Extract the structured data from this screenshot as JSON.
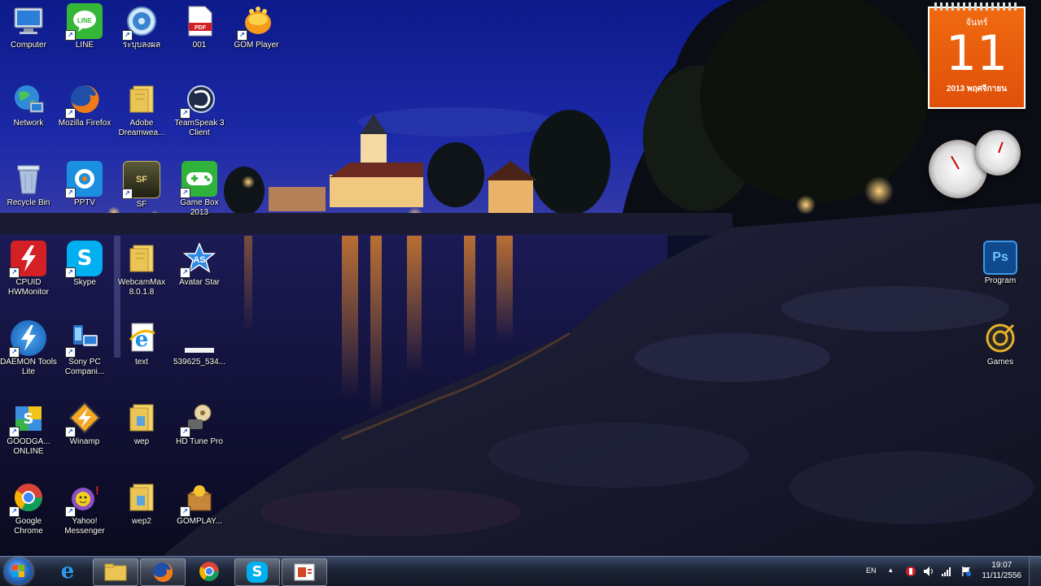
{
  "desktop_icons": {
    "computer": "Computer",
    "line": "LINE",
    "network_folder": "ระบุบลงผล",
    "file_001": "001",
    "gom_player": "GOM Player",
    "network": "Network",
    "firefox": "Mozilla Firefox",
    "dreamweaver": "Adobe Dreamwea...",
    "teamspeak": "TeamSpeak 3 Client",
    "recycle_bin": "Recycle Bin",
    "pptv": "PPTV",
    "sf": "SF",
    "game_box": "Game Box 2013",
    "cpuid": "CPUID HWMonitor",
    "skype": "Skype",
    "webcammax": "WebcamMax 8.0.1.8",
    "avatar_star": "Avatar Star",
    "daemon": "DAEMON Tools Lite",
    "sony_pc": "Sony PC Compani...",
    "text": "text",
    "file_539625": "539625_534...",
    "goodgame": "GOODGA... ONLINE",
    "winamp": "Winamp",
    "wep": "wep",
    "hdtune": "HD Tune Pro",
    "chrome": "Google Chrome",
    "yahoo": "Yahoo! Messenger",
    "wep2": "wep2",
    "gomplay": "GOMPLAY...",
    "program": "Program",
    "games": "Games"
  },
  "calendar": {
    "day_name": "จันทร์",
    "day": "11",
    "month_year": "2013 พฤศจิกายน"
  },
  "taskbar": {
    "language": "EN",
    "time": "19:07",
    "date": "11/11/2556"
  },
  "colors": {
    "calendar_orange": "#e8590c",
    "taskbar_dark": "#1b2335"
  }
}
